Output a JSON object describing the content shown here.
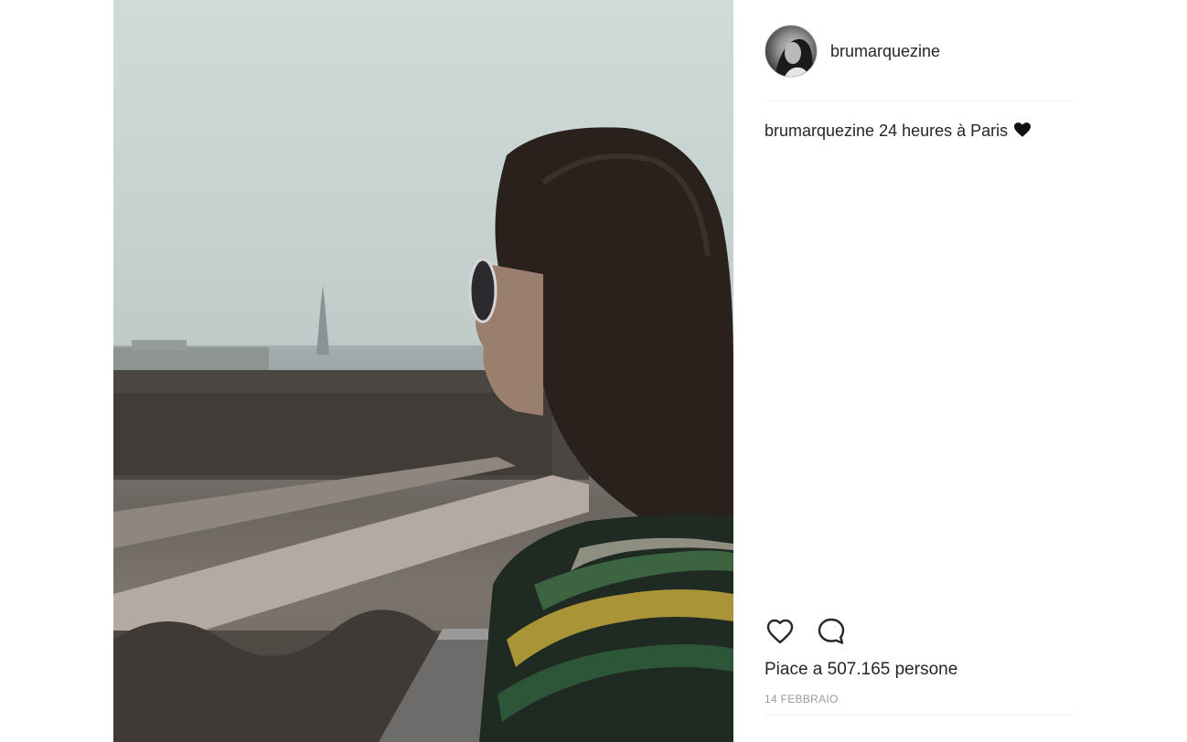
{
  "post": {
    "image_alt": "",
    "author": {
      "username": "brumarquezine",
      "avatar_icon": "avatar-photo"
    },
    "caption": {
      "username": "brumarquezine",
      "text": " 24 heures à Paris ",
      "emoji_icon": "black-heart-icon"
    },
    "actions": {
      "like_icon": "heart-outline-icon",
      "comment_icon": "comment-bubble-icon"
    },
    "likes_text": "Piace a 507.165 persone",
    "date": "14 FEBBRAIO"
  },
  "colors": {
    "text": "#262626",
    "muted": "#999999",
    "divider": "#efefef"
  }
}
